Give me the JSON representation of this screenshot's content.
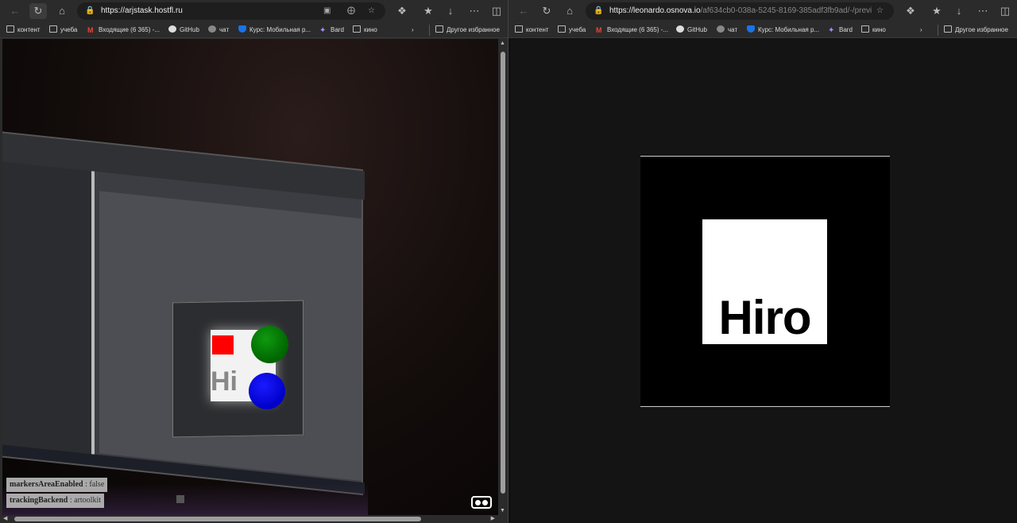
{
  "left_window": {
    "url_host": "https://arjstask.hostfl.ru",
    "url_rest": ""
  },
  "right_window": {
    "url_host": "https://leonardo.osnova.io",
    "url_rest": "/af634cb0-038a-5245-8169-385adf3fb9ad/-/previ..."
  },
  "bookmarks": [
    {
      "label": "контент",
      "icon": "folder-icon"
    },
    {
      "label": "учеба",
      "icon": "folder-icon"
    },
    {
      "label": "Входящие (6 365) -...",
      "icon": "gmail-icon"
    },
    {
      "label": "GitHub",
      "icon": "github-icon"
    },
    {
      "label": "чат",
      "icon": "chat-icon"
    },
    {
      "label": "Курс: Мобильная р...",
      "icon": "shield-icon"
    },
    {
      "label": "Bard",
      "icon": "bard-icon"
    },
    {
      "label": "кино",
      "icon": "folder-icon"
    }
  ],
  "other_favorites": "Другое избранное",
  "debug": {
    "markers_key": "markersAreaEnabled",
    "markers_val": "false",
    "tracking_key": "trackingBackend",
    "tracking_val": "artoolkit"
  },
  "marker_text": "Hiro",
  "camera_marker_text": "Hi",
  "colors": {
    "cube": "#ff0000",
    "sphere_green": "#008000",
    "sphere_blue": "#0000ff"
  }
}
